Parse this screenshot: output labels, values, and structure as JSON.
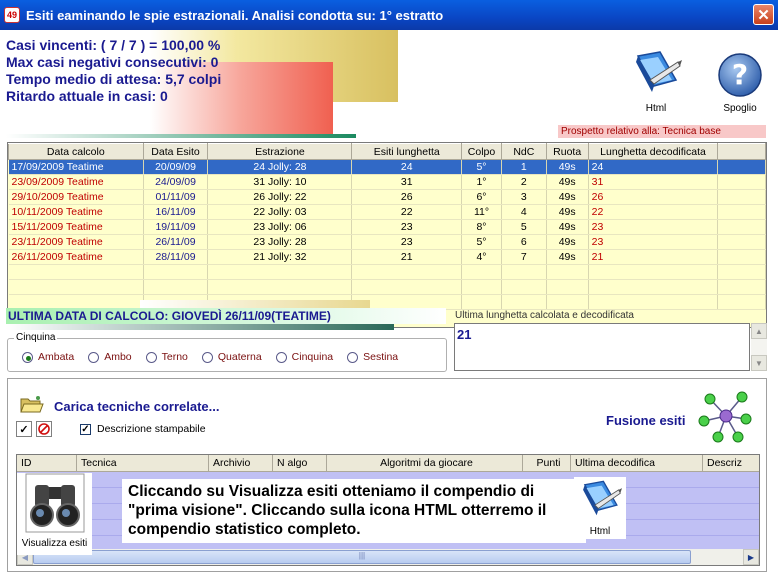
{
  "window": {
    "title": "Esiti eaminando le spie estrazionali. Analisi condotta su: 1° estratto",
    "app_icon_text": "49",
    "close_glyph": "✕"
  },
  "stats": {
    "line1": "Casi vincenti: ( 7 / 7 ) = 100,00 %",
    "line2": "Max casi negativi consecutivi: 0",
    "line3": "Tempo medio di attesa: 5,7 colpi",
    "line4": "Ritardo attuale in casi: 0"
  },
  "toolbar": {
    "html_label": "Html",
    "spoglio_label": "Spoglio",
    "spoglio_glyph": "?"
  },
  "prospetto": "Prospetto relativo alla: Tecnica base",
  "table": {
    "headers": [
      "Data calcolo",
      "Data Esito",
      "Estrazione",
      "Esiti lunghetta",
      "Colpo",
      "NdC",
      "Ruota",
      "Lunghetta decodificata"
    ],
    "rows": [
      [
        "17/09/2009 Teatime",
        "20/09/09",
        "24 Jolly: 28",
        "24",
        "5°",
        "1",
        "49s",
        "24"
      ],
      [
        "23/09/2009 Teatime",
        "24/09/09",
        "31 Jolly: 10",
        "31",
        "1°",
        "2",
        "49s",
        "31"
      ],
      [
        "29/10/2009 Teatime",
        "01/11/09",
        "26 Jolly: 22",
        "26",
        "6°",
        "3",
        "49s",
        "26"
      ],
      [
        "10/11/2009 Teatime",
        "16/11/09",
        "22 Jolly: 03",
        "22",
        "11°",
        "4",
        "49s",
        "22"
      ],
      [
        "15/11/2009 Teatime",
        "19/11/09",
        "23 Jolly: 06",
        "23",
        "8°",
        "5",
        "49s",
        "23"
      ],
      [
        "23/11/2009 Teatime",
        "26/11/09",
        "23 Jolly: 28",
        "23",
        "5°",
        "6",
        "49s",
        "23"
      ],
      [
        "26/11/2009 Teatime",
        "28/11/09",
        "21 Jolly: 32",
        "21",
        "4°",
        "7",
        "49s",
        "21"
      ]
    ]
  },
  "ultima_data": "ULTIMA DATA DI CALCOLO: GIOVEDÌ 26/11/09(TEATIME)",
  "cinquina": {
    "legend": "Cinquina",
    "options": [
      "Ambata",
      "Ambo",
      "Terno",
      "Quaterna",
      "Cinquina",
      "Sestina"
    ],
    "selected": "Ambata"
  },
  "lunghetta": {
    "label": "Ultima lunghetta calcolata e decodificata",
    "value": "21"
  },
  "bottom": {
    "carica_label": "Carica tecniche correlate...",
    "check_glyph": "✓",
    "descrizione_label": "Descrizione stampabile",
    "descrizione_checked": "✓",
    "fusione_label": "Fusione esiti",
    "grid_headers": [
      "ID",
      "Tecnica",
      "Archivio",
      "N algo",
      "Algoritmi da giocare",
      "Punti",
      "Ultima decodifica",
      "Descriz"
    ],
    "visualizza_label": "Visualizza esiti",
    "html_label": "Html",
    "scroll_thumb": "|||",
    "overlay_text": "Cliccando su Visualizza esiti otteniamo il compendio di \"prima visione\". Cliccando sulla icona HTML otterremo il compendio statistico completo."
  }
}
